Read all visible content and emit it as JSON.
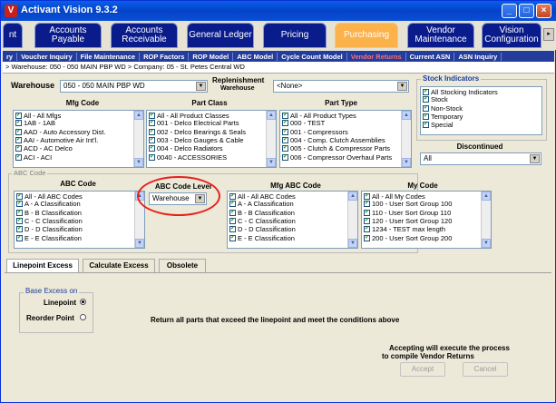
{
  "window": {
    "title": "Activant Vision 9.3.2",
    "app_icon": "V"
  },
  "main_tabs": [
    {
      "label": "nt"
    },
    {
      "label": "Accounts Payable"
    },
    {
      "label": "Accounts Receivable"
    },
    {
      "label": "General Ledger"
    },
    {
      "label": "Pricing"
    },
    {
      "label": "Purchasing",
      "active": true
    },
    {
      "label": "Vendor Maintenance"
    },
    {
      "label": "Vision Configuration"
    }
  ],
  "sub_tabs": [
    {
      "label": "ry"
    },
    {
      "label": "Voucher Inquiry"
    },
    {
      "label": "File Maintenance"
    },
    {
      "label": "ROP Factors"
    },
    {
      "label": "ROP Model"
    },
    {
      "label": "ABC Model"
    },
    {
      "label": "Cycle Count Model"
    },
    {
      "label": "Vendor Returns",
      "active": true
    },
    {
      "label": "Current ASN"
    },
    {
      "label": "ASN Inquiry"
    }
  ],
  "infobar": "> Warehouse: 050 - 050 MAIN PBP WD > Company: 05 - St. Petes Central WD",
  "warehouse": {
    "label": "Warehouse",
    "value": "050 - 050 MAIN PBP WD"
  },
  "replenishment": {
    "label_line1": "Replenishment",
    "label_line2": "Warehouse",
    "value": "<None>"
  },
  "mfg_code": {
    "label": "Mfg Code",
    "items": [
      "All - All Mfgs",
      "1AB - 1AB",
      "AAD - Auto Accessory Dist.",
      "AAI - Automotive Air Int'l.",
      "ACD - AC Delco",
      "ACI - ACI"
    ]
  },
  "part_class": {
    "label": "Part Class",
    "items": [
      "All - All Product Classes",
      "001 - Delco Electrical Parts",
      "002 - Delco Bearings & Seals",
      "003 - Delco Gauges & Cable",
      "004 - Delco Radiators",
      "0040 - ACCESSORIES"
    ]
  },
  "part_type": {
    "label": "Part Type",
    "items": [
      "All - All Product Types",
      "000 - TEST",
      "001 - Compressors",
      "004 - Comp. Clutch Assemblies",
      "005 - Clutch & Compressor Parts",
      "006 - Compressor Overhaul Parts"
    ]
  },
  "stock_indicators": {
    "label": "Stock Indicators",
    "items": [
      "All Stocking Indicators",
      "Stock",
      "Non-Stock",
      "Temporary",
      "Special"
    ]
  },
  "discontinued": {
    "label": "Discontinued",
    "value": "All"
  },
  "abc_group_label": "ABC Code",
  "abc_code": {
    "label": "ABC Code",
    "items": [
      "All - All ABC Codes",
      "A - A Classification",
      "B - B Classification",
      "C - C Classification",
      "D - D Classification",
      "E - E Classification"
    ]
  },
  "abc_code_level": {
    "label": "ABC Code Level",
    "value": "Warehouse"
  },
  "mfg_abc_code": {
    "label": "Mfg ABC Code",
    "items": [
      "All - All ABC Codes",
      "A - A Classification",
      "B - B Classification",
      "C - C Classification",
      "D - D Classification",
      "E - E Classification"
    ]
  },
  "my_code": {
    "label": "My Code",
    "items": [
      "All - All My Codes",
      "100 - User Sort Group 100",
      "110 - User Sort Group 110",
      "120 - User Sort Group 120",
      "1234 - TEST max length",
      "200 - User Sort Group 200"
    ]
  },
  "bottom_tabs": [
    {
      "label": "Linepoint Excess",
      "active": true
    },
    {
      "label": "Calculate Excess"
    },
    {
      "label": "Obsolete"
    }
  ],
  "base_excess": {
    "label": "Base Excess on",
    "options": [
      {
        "label": "Linepoint",
        "selected": true
      },
      {
        "label": "Reorder Point",
        "selected": false
      }
    ]
  },
  "description": "Return all parts that exceed the linepoint and meet the conditions above",
  "accept_note_line1": "Accepting will execute the process",
  "accept_note_line2": "to compile Vendor Returns",
  "buttons": {
    "accept": "Accept",
    "cancel": "Cancel"
  },
  "colors": {
    "accent_active_tab": "#fbb24a",
    "tab_bg": "#0a1c8c",
    "highlight_circle": "#e8201c"
  }
}
